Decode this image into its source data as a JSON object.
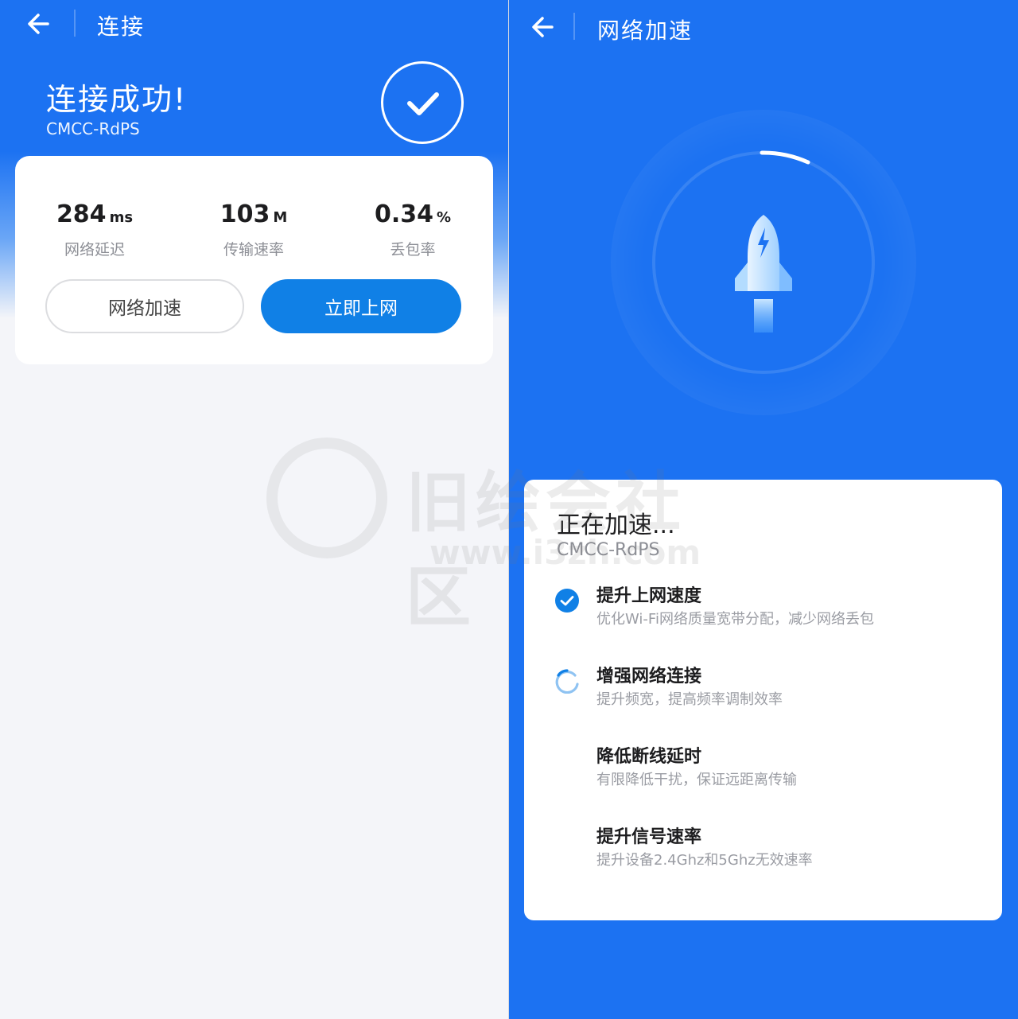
{
  "left": {
    "header": {
      "title": "连接"
    },
    "status": {
      "title": "连接成功!",
      "ssid": "CMCC-RdPS"
    },
    "stats": [
      {
        "value": "284",
        "unit": "ms",
        "label": "网络延迟"
      },
      {
        "value": "103",
        "unit": "M",
        "label": "传输速率"
      },
      {
        "value": "0.34",
        "unit": "%",
        "label": "丢包率"
      }
    ],
    "buttons": {
      "accelerate": "网络加速",
      "go_online": "立即上网"
    }
  },
  "right": {
    "header": {
      "title": "网络加速"
    },
    "card": {
      "title": "正在加速...",
      "ssid": "CMCC-RdPS",
      "steps": [
        {
          "title": "提升上网速度",
          "desc": "优化Wi-Fi网络质量宽带分配，减少网络丢包",
          "state": "done"
        },
        {
          "title": "增强网络连接",
          "desc": "提升频宽，提高频率调制效率",
          "state": "loading"
        },
        {
          "title": "降低断线延时",
          "desc": "有限降低干扰，保证远距离传输",
          "state": "pending"
        },
        {
          "title": "提升信号速率",
          "desc": "提升设备2.4Ghz和5Ghz无效速率",
          "state": "pending"
        }
      ]
    }
  },
  "watermark": {
    "text": "旧绘会社区",
    "url": "www.i3zh.com"
  },
  "colors": {
    "primary": "#1c72f2",
    "button": "#1080e6",
    "background": "#f4f5f9"
  }
}
